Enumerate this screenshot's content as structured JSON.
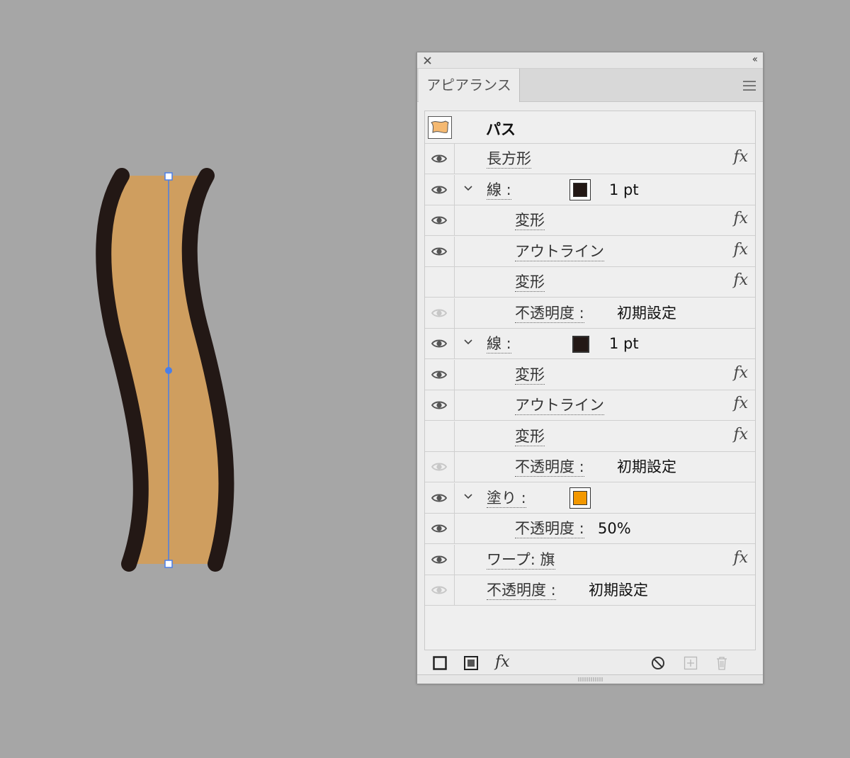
{
  "panel": {
    "tab_title": "アピアランス",
    "object_title": "パス",
    "rows": [
      {
        "label": "長方形",
        "value": "",
        "indent": 0,
        "eye": "on",
        "fx": true,
        "chevron": false
      },
      {
        "label": "線 :",
        "value": "1 pt",
        "indent": 0,
        "eye": "on",
        "fx": false,
        "chevron": true,
        "swatch": "stroke",
        "swatch_color": "#231815"
      },
      {
        "label": "変形",
        "value": "",
        "indent": 1,
        "eye": "on",
        "fx": true
      },
      {
        "label": "アウトライン",
        "value": "",
        "indent": 1,
        "eye": "on",
        "fx": true
      },
      {
        "label": "変形",
        "value": "",
        "indent": 1,
        "eye": "none",
        "fx": true
      },
      {
        "label": "不透明度 :",
        "value": "初期設定",
        "indent": 1,
        "eye": "dim",
        "fx": false
      },
      {
        "label": "線 :",
        "value": "1 pt",
        "indent": 0,
        "eye": "on",
        "fx": false,
        "chevron": true,
        "swatch": "stroke2",
        "swatch_color": "#231815"
      },
      {
        "label": "変形",
        "value": "",
        "indent": 1,
        "eye": "on",
        "fx": true
      },
      {
        "label": "アウトライン",
        "value": "",
        "indent": 1,
        "eye": "on",
        "fx": true
      },
      {
        "label": "変形",
        "value": "",
        "indent": 1,
        "eye": "none",
        "fx": true
      },
      {
        "label": "不透明度 :",
        "value": "初期設定",
        "indent": 1,
        "eye": "dim",
        "fx": false
      },
      {
        "label": "塗り :",
        "value": "",
        "indent": 0,
        "eye": "on",
        "fx": false,
        "chevron": true,
        "swatch": "fill",
        "swatch_color": "#f39800"
      },
      {
        "label": "不透明度 :",
        "value": "50%",
        "indent": 1,
        "eye": "on",
        "fx": false
      },
      {
        "label": "ワープ: 旗",
        "value": "",
        "indent": 0,
        "eye": "on",
        "fx": true
      },
      {
        "label": "不透明度 :",
        "value": "初期設定",
        "indent": 0,
        "eye": "dim",
        "fx": false
      }
    ],
    "fx_symbol": "fx"
  },
  "colors": {
    "artwork_fill": "#cf9e5f",
    "artwork_stroke": "#231815",
    "selection": "#4a7fe8"
  }
}
